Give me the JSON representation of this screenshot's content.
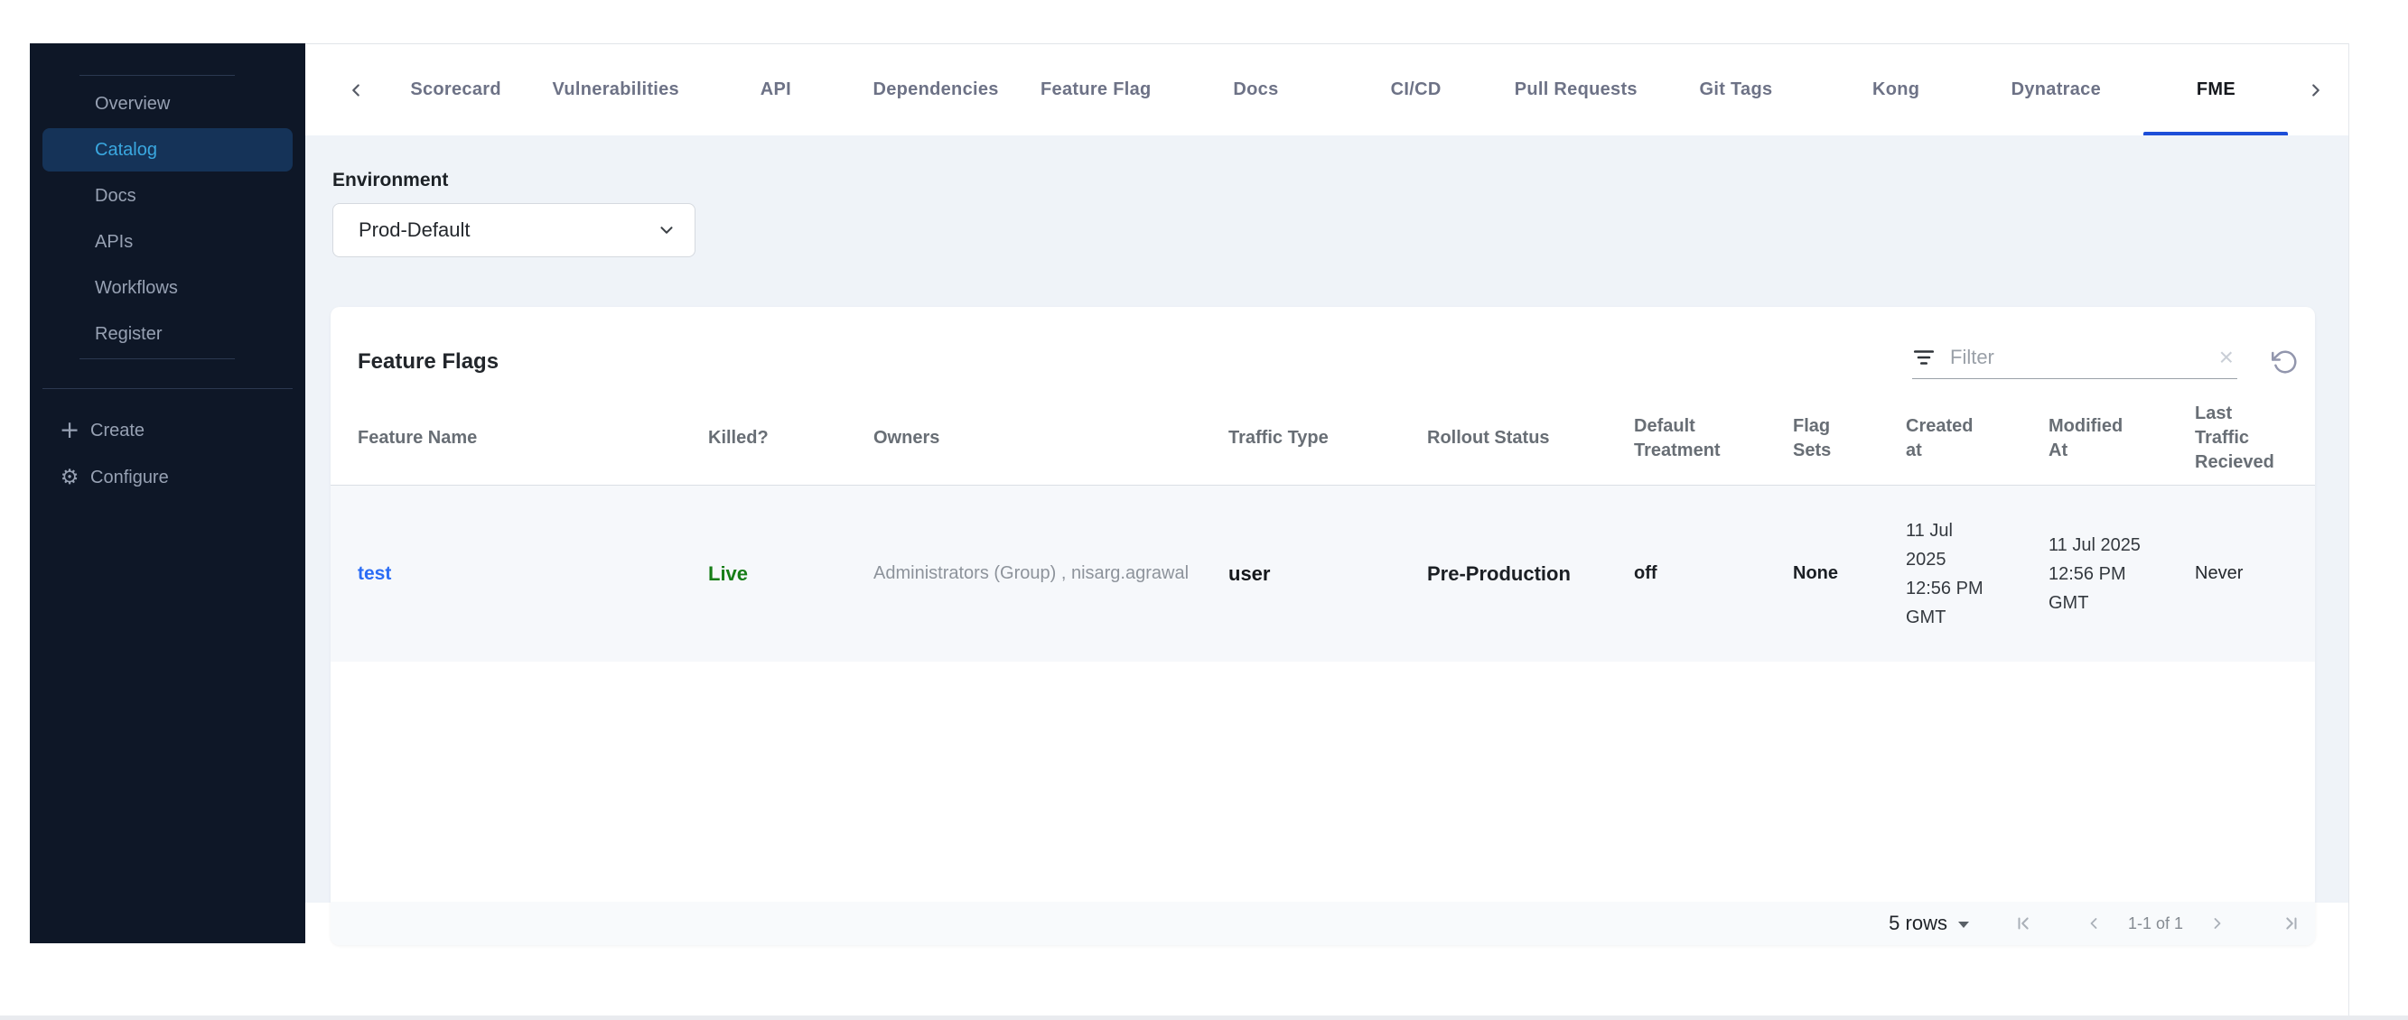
{
  "sidebar": {
    "items": [
      "Overview",
      "Catalog",
      "Docs",
      "APIs",
      "Workflows",
      "Register"
    ],
    "active": "Catalog",
    "create_label": "Create",
    "configure_label": "Configure"
  },
  "icons": {
    "create": "+",
    "configure": "⚙"
  },
  "tabs": {
    "items": [
      "Scorecard",
      "Vulnerabilities",
      "API",
      "Dependencies",
      "Feature Flag",
      "Docs",
      "CI/CD",
      "Pull Requests",
      "Git Tags",
      "Kong",
      "Dynatrace",
      "FME"
    ],
    "active": "FME"
  },
  "environment": {
    "label": "Environment",
    "value": "Prod-Default"
  },
  "panel": {
    "title": "Feature Flags",
    "filter": {
      "placeholder": "Filter",
      "clear_icon": "×"
    },
    "table": {
      "columns": [
        "Feature Name",
        "Killed?",
        "Owners",
        "Traffic Type",
        "Rollout Status",
        "Default Treatment",
        "Flag Sets",
        "Created at",
        "Modified At",
        "Last Traffic Recieved"
      ],
      "rows": [
        {
          "feature_name": "test",
          "killed": "Live",
          "owners": "Administrators (Group) , nisarg.agrawal",
          "traffic_type": "user",
          "rollout_status": "Pre-Production",
          "default_treatment": "off",
          "flag_sets": "None",
          "created_at": "11 Jul 2025 12:56 PM GMT",
          "modified_at": "11 Jul 2025 12:56 PM GMT",
          "last_traffic_recieved": "Never"
        }
      ]
    },
    "pagination": {
      "rows_per_page": "5 rows",
      "range": "1-1 of 1"
    }
  },
  "colors": {
    "sidebar_bg": "#0e1727",
    "sidebar_active_bg": "#153358",
    "sidebar_active_text": "#3aa8e0",
    "tab_active_underline": "#1d4ed8",
    "link_blue": "#2a6cf5",
    "live_green": "#177d17",
    "page_bg": "#eff3f8",
    "row_tint": "#f6f8fb"
  }
}
